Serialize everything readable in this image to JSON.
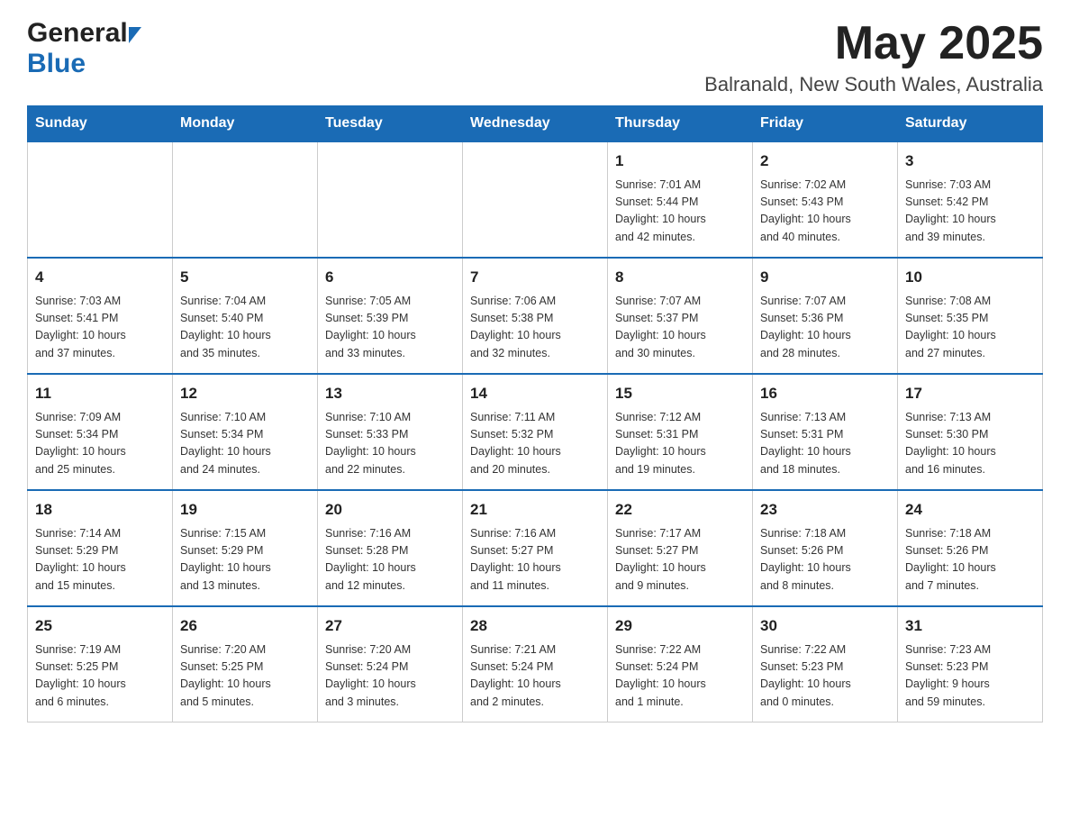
{
  "header": {
    "logo_general": "General",
    "logo_blue": "Blue",
    "month_title": "May 2025",
    "location": "Balranald, New South Wales, Australia"
  },
  "days_of_week": [
    "Sunday",
    "Monday",
    "Tuesday",
    "Wednesday",
    "Thursday",
    "Friday",
    "Saturday"
  ],
  "weeks": [
    [
      {
        "day": "",
        "info": ""
      },
      {
        "day": "",
        "info": ""
      },
      {
        "day": "",
        "info": ""
      },
      {
        "day": "",
        "info": ""
      },
      {
        "day": "1",
        "info": "Sunrise: 7:01 AM\nSunset: 5:44 PM\nDaylight: 10 hours\nand 42 minutes."
      },
      {
        "day": "2",
        "info": "Sunrise: 7:02 AM\nSunset: 5:43 PM\nDaylight: 10 hours\nand 40 minutes."
      },
      {
        "day": "3",
        "info": "Sunrise: 7:03 AM\nSunset: 5:42 PM\nDaylight: 10 hours\nand 39 minutes."
      }
    ],
    [
      {
        "day": "4",
        "info": "Sunrise: 7:03 AM\nSunset: 5:41 PM\nDaylight: 10 hours\nand 37 minutes."
      },
      {
        "day": "5",
        "info": "Sunrise: 7:04 AM\nSunset: 5:40 PM\nDaylight: 10 hours\nand 35 minutes."
      },
      {
        "day": "6",
        "info": "Sunrise: 7:05 AM\nSunset: 5:39 PM\nDaylight: 10 hours\nand 33 minutes."
      },
      {
        "day": "7",
        "info": "Sunrise: 7:06 AM\nSunset: 5:38 PM\nDaylight: 10 hours\nand 32 minutes."
      },
      {
        "day": "8",
        "info": "Sunrise: 7:07 AM\nSunset: 5:37 PM\nDaylight: 10 hours\nand 30 minutes."
      },
      {
        "day": "9",
        "info": "Sunrise: 7:07 AM\nSunset: 5:36 PM\nDaylight: 10 hours\nand 28 minutes."
      },
      {
        "day": "10",
        "info": "Sunrise: 7:08 AM\nSunset: 5:35 PM\nDaylight: 10 hours\nand 27 minutes."
      }
    ],
    [
      {
        "day": "11",
        "info": "Sunrise: 7:09 AM\nSunset: 5:34 PM\nDaylight: 10 hours\nand 25 minutes."
      },
      {
        "day": "12",
        "info": "Sunrise: 7:10 AM\nSunset: 5:34 PM\nDaylight: 10 hours\nand 24 minutes."
      },
      {
        "day": "13",
        "info": "Sunrise: 7:10 AM\nSunset: 5:33 PM\nDaylight: 10 hours\nand 22 minutes."
      },
      {
        "day": "14",
        "info": "Sunrise: 7:11 AM\nSunset: 5:32 PM\nDaylight: 10 hours\nand 20 minutes."
      },
      {
        "day": "15",
        "info": "Sunrise: 7:12 AM\nSunset: 5:31 PM\nDaylight: 10 hours\nand 19 minutes."
      },
      {
        "day": "16",
        "info": "Sunrise: 7:13 AM\nSunset: 5:31 PM\nDaylight: 10 hours\nand 18 minutes."
      },
      {
        "day": "17",
        "info": "Sunrise: 7:13 AM\nSunset: 5:30 PM\nDaylight: 10 hours\nand 16 minutes."
      }
    ],
    [
      {
        "day": "18",
        "info": "Sunrise: 7:14 AM\nSunset: 5:29 PM\nDaylight: 10 hours\nand 15 minutes."
      },
      {
        "day": "19",
        "info": "Sunrise: 7:15 AM\nSunset: 5:29 PM\nDaylight: 10 hours\nand 13 minutes."
      },
      {
        "day": "20",
        "info": "Sunrise: 7:16 AM\nSunset: 5:28 PM\nDaylight: 10 hours\nand 12 minutes."
      },
      {
        "day": "21",
        "info": "Sunrise: 7:16 AM\nSunset: 5:27 PM\nDaylight: 10 hours\nand 11 minutes."
      },
      {
        "day": "22",
        "info": "Sunrise: 7:17 AM\nSunset: 5:27 PM\nDaylight: 10 hours\nand 9 minutes."
      },
      {
        "day": "23",
        "info": "Sunrise: 7:18 AM\nSunset: 5:26 PM\nDaylight: 10 hours\nand 8 minutes."
      },
      {
        "day": "24",
        "info": "Sunrise: 7:18 AM\nSunset: 5:26 PM\nDaylight: 10 hours\nand 7 minutes."
      }
    ],
    [
      {
        "day": "25",
        "info": "Sunrise: 7:19 AM\nSunset: 5:25 PM\nDaylight: 10 hours\nand 6 minutes."
      },
      {
        "day": "26",
        "info": "Sunrise: 7:20 AM\nSunset: 5:25 PM\nDaylight: 10 hours\nand 5 minutes."
      },
      {
        "day": "27",
        "info": "Sunrise: 7:20 AM\nSunset: 5:24 PM\nDaylight: 10 hours\nand 3 minutes."
      },
      {
        "day": "28",
        "info": "Sunrise: 7:21 AM\nSunset: 5:24 PM\nDaylight: 10 hours\nand 2 minutes."
      },
      {
        "day": "29",
        "info": "Sunrise: 7:22 AM\nSunset: 5:24 PM\nDaylight: 10 hours\nand 1 minute."
      },
      {
        "day": "30",
        "info": "Sunrise: 7:22 AM\nSunset: 5:23 PM\nDaylight: 10 hours\nand 0 minutes."
      },
      {
        "day": "31",
        "info": "Sunrise: 7:23 AM\nSunset: 5:23 PM\nDaylight: 9 hours\nand 59 minutes."
      }
    ]
  ]
}
